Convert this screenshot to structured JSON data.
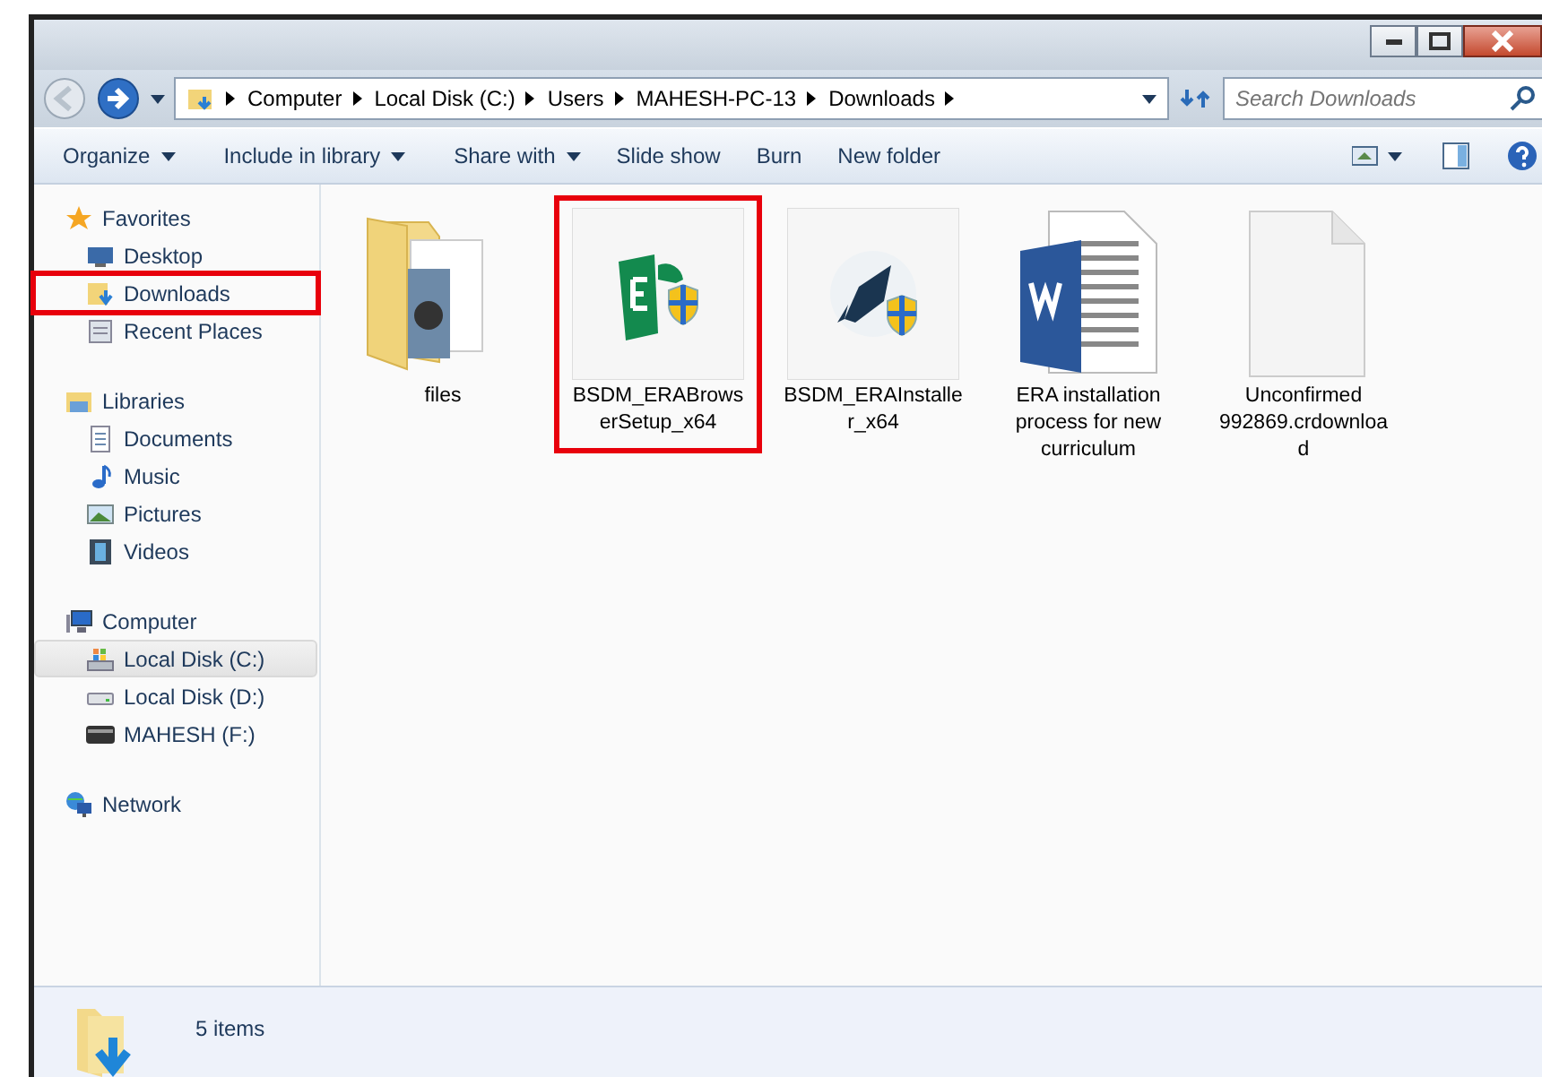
{
  "address": {
    "crumbs": [
      "Computer",
      "Local Disk (C:)",
      "Users",
      "MAHESH-PC-13",
      "Downloads"
    ],
    "search_placeholder": "Search Downloads"
  },
  "toolbar": [
    {
      "label": "Organize",
      "dropdown": true
    },
    {
      "label": "Include in library",
      "dropdown": true
    },
    {
      "label": "Share with",
      "dropdown": true
    },
    {
      "label": "Slide show",
      "dropdown": false
    },
    {
      "label": "Burn",
      "dropdown": false
    },
    {
      "label": "New folder",
      "dropdown": false
    }
  ],
  "nav": [
    {
      "label": "Favorites",
      "kind": "star",
      "children": [
        {
          "label": "Desktop",
          "kind": "desktop",
          "selected": false,
          "highlighted": false
        },
        {
          "label": "Downloads",
          "kind": "downloads",
          "selected": false,
          "highlighted": true
        },
        {
          "label": "Recent Places",
          "kind": "recent",
          "selected": false,
          "highlighted": false
        }
      ]
    },
    {
      "label": "Libraries",
      "kind": "library",
      "children": [
        {
          "label": "Documents",
          "kind": "document",
          "selected": false,
          "highlighted": false
        },
        {
          "label": "Music",
          "kind": "music",
          "selected": false,
          "highlighted": false
        },
        {
          "label": "Pictures",
          "kind": "pictures",
          "selected": false,
          "highlighted": false
        },
        {
          "label": "Videos",
          "kind": "videos",
          "selected": false,
          "highlighted": false
        }
      ]
    },
    {
      "label": "Computer",
      "kind": "computer",
      "children": [
        {
          "label": "Local Disk (C:)",
          "kind": "sysdisk",
          "selected": true,
          "highlighted": false
        },
        {
          "label": "Local Disk (D:)",
          "kind": "disk",
          "selected": false,
          "highlighted": false
        },
        {
          "label": "MAHESH (F:)",
          "kind": "usb",
          "selected": false,
          "highlighted": false
        }
      ]
    },
    {
      "label": "Network",
      "kind": "network"
    }
  ],
  "files": [
    {
      "name": "files",
      "kind": "folder",
      "highlighted": false
    },
    {
      "name": "BSDM_ERABrowserSetup_x64",
      "kind": "era",
      "highlighted": true
    },
    {
      "name": "BSDM_ERAInstaller_x64",
      "kind": "rocket",
      "highlighted": false
    },
    {
      "name": "ERA installation process for new curriculum",
      "kind": "word",
      "highlighted": false
    },
    {
      "name": "Unconfirmed 992869.crdownload",
      "kind": "blank",
      "highlighted": false
    }
  ],
  "status": {
    "count": "5 items"
  }
}
